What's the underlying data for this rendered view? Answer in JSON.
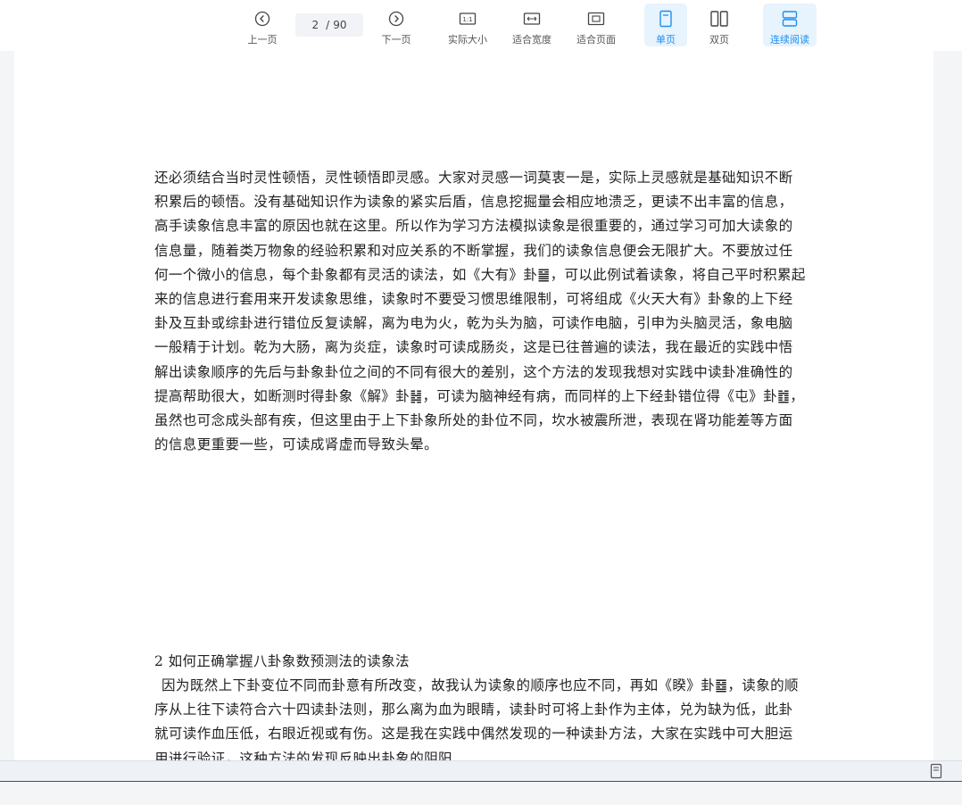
{
  "toolbar": {
    "prev_label": "上一页",
    "current_page": "2",
    "page_sep": "/",
    "total_pages": "90",
    "next_label": "下一页",
    "actual_size_label": "实际大小",
    "fit_width_label": "适合宽度",
    "fit_page_label": "适合页面",
    "single_page_label": "单页",
    "double_page_label": "双页",
    "continuous_label": "连续阅读",
    "accent_color": "#1e8ef0"
  },
  "content": {
    "paragraph1": "还必须结合当时灵性顿悟，灵性顿悟即灵感。大家对灵感一词莫衷一是，实际上灵感就是基础知识不断积累后的顿悟。没有基础知识作为读象的紧实后盾，信息挖掘量会相应地溃乏，更读不出丰富的信息，高手读象信息丰富的原因也就在这里。所以作为学习方法模拟读象是很重要的，通过学习可加大读象的信息量，随着类万物象的经验积累和对应关系的不断掌握，我们的读象信息便会无限扩大。不要放过任何一个微小的信息，每个卦象都有灵活的读法，如《大有》卦䷍，可以此例试着读象，将自己平时积累起来的信息进行套用来开发读象思维，读象时不要受习惯思维限制，可将组成《火天大有》卦象的上下经卦及互卦或综卦进行错位反复读解，离为电为火，乾为头为脑，可读作电脑，引申为头脑灵活，象电脑一般精于计划。乾为大肠，离为炎症，读象时可读成肠炎，这是已往普遍的读法，我在最近的实践中悟解出读象顺序的先后与卦象卦位之间的不同有很大的差别，这个方法的发现我想对实践中读卦准确性的提高帮助很大，如断测时得卦象《解》卦䷧，可读为脑神经有病，而同样的上下经卦错位得《屯》卦䷂，虽然也可念成头部有疾，但这里由于上下卦象所处的卦位不同，坎水被震所泄，表现在肾功能差等方面的信息更重要一些，可读成肾虚而导致头晕。",
    "heading": "2 如何正确掌握八卦象数预测法的读象法",
    "paragraph2": "因为既然上下卦变位不同而卦意有所改变，故我认为读象的顺序也应不同，再如《睽》卦䷥，读象的顺序从上往下读符合六十四读卦法则，那么离为血为眼睛，读卦时可将上卦作为主体，兑为缺为低，此卦就可读作血压低，右眼近视或有伤。这是我在实践中偶然发现的一种读卦方法，大家在实践中可大胆运用进行验证，这种方法的发现反映出卦象的阴阳"
  }
}
